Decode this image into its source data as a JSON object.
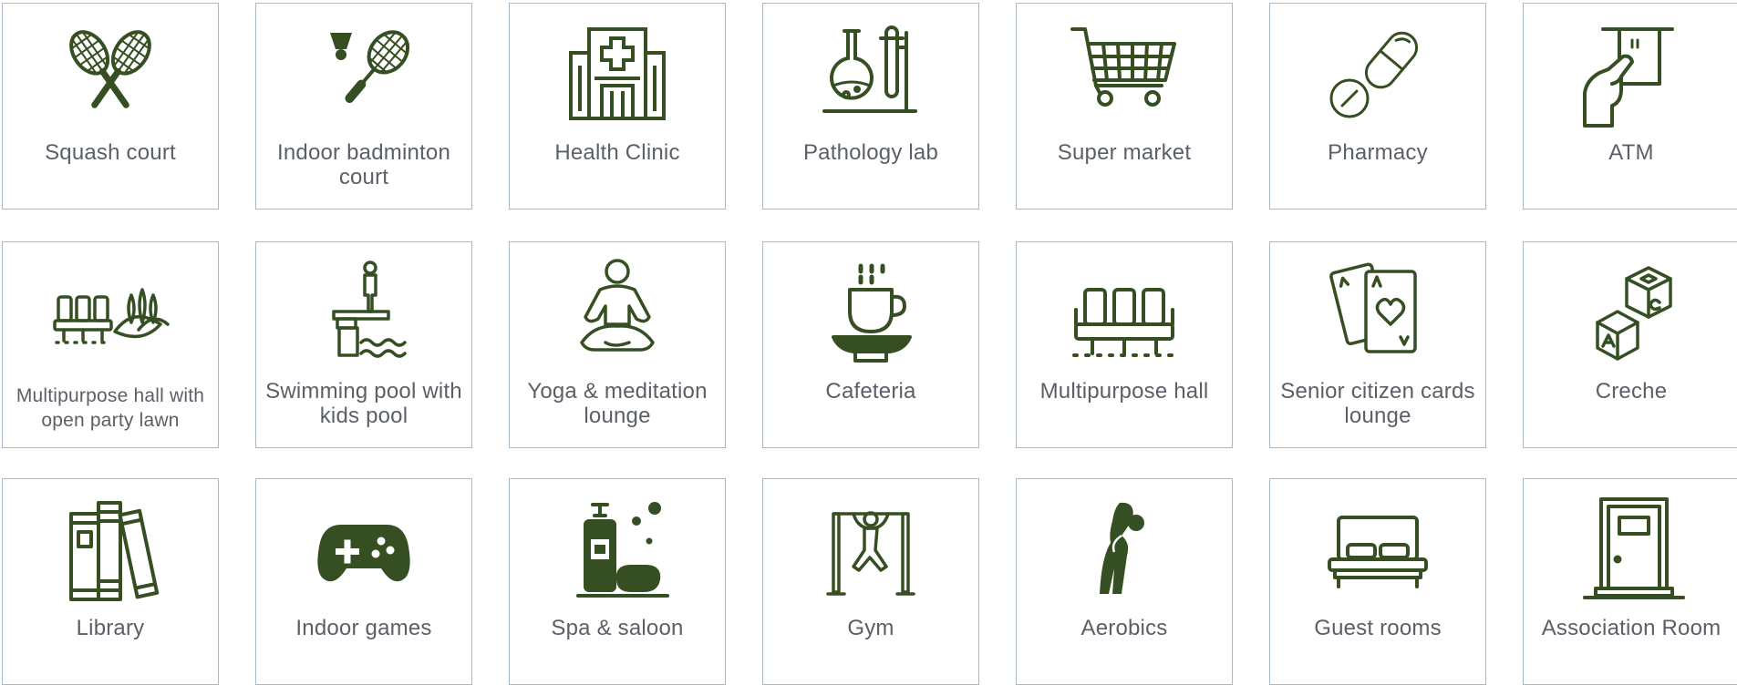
{
  "colors": {
    "icon": "#354f23",
    "label": "#5b6068",
    "border": "#a9b8c6",
    "background": "#ffffff"
  },
  "amenities": [
    {
      "label": "Squash court",
      "icon": "squash-rackets-icon"
    },
    {
      "label": "Indoor badminton court",
      "icon": "badminton-icon"
    },
    {
      "label": "Health Clinic",
      "icon": "hospital-icon"
    },
    {
      "label": "Pathology lab",
      "icon": "lab-flask-icon"
    },
    {
      "label": "Super market",
      "icon": "shopping-cart-icon"
    },
    {
      "label": "Pharmacy",
      "icon": "pill-icon"
    },
    {
      "label": "ATM",
      "icon": "atm-card-icon"
    },
    {
      "label": "Multipurpose hall with open party lawn",
      "icon": "hall-lawn-icon"
    },
    {
      "label": "Swimming pool with kids pool",
      "icon": "diving-board-icon"
    },
    {
      "label": "Yoga & meditation lounge",
      "icon": "meditation-icon"
    },
    {
      "label": "Cafeteria",
      "icon": "coffee-cup-icon"
    },
    {
      "label": "Multipurpose hall",
      "icon": "hall-seats-icon"
    },
    {
      "label": "Senior citizen cards lounge",
      "icon": "playing-cards-icon"
    },
    {
      "label": "Creche",
      "icon": "toy-blocks-icon"
    },
    {
      "label": "Library",
      "icon": "books-icon"
    },
    {
      "label": "Indoor games",
      "icon": "gamepad-icon"
    },
    {
      "label": "Spa & saloon",
      "icon": "spa-icon"
    },
    {
      "label": "Gym",
      "icon": "gym-bar-icon"
    },
    {
      "label": "Aerobics",
      "icon": "aerobics-icon"
    },
    {
      "label": "Guest rooms",
      "icon": "bed-icon"
    },
    {
      "label": "Association Room",
      "icon": "door-icon"
    }
  ]
}
